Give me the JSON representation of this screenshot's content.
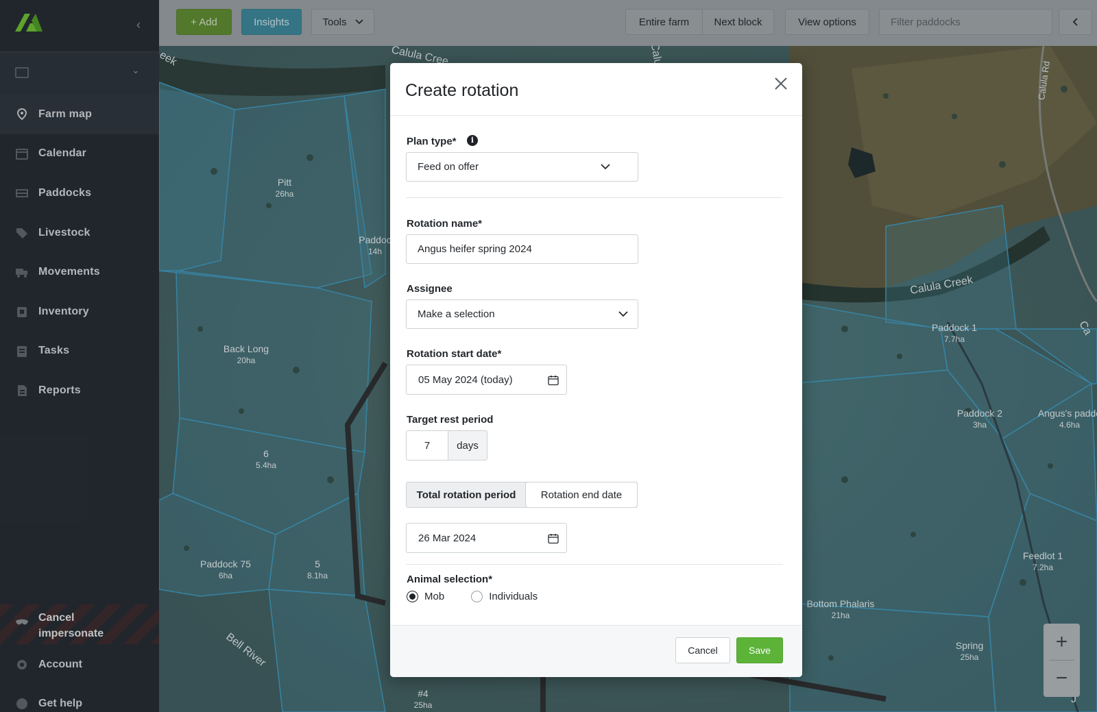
{
  "sidebar": {
    "farm_selector": {
      "value": ""
    },
    "items": [
      {
        "label": "Farm map",
        "icon": "map-pin-icon",
        "active": true
      },
      {
        "label": "Calendar",
        "icon": "calendar-icon"
      },
      {
        "label": "Paddocks",
        "icon": "fence-icon"
      },
      {
        "label": "Livestock",
        "icon": "tag-icon"
      },
      {
        "label": "Movements",
        "icon": "truck-icon"
      },
      {
        "label": "Inventory",
        "icon": "box-icon"
      },
      {
        "label": "Tasks",
        "icon": "clipboard-icon"
      },
      {
        "label": "Reports",
        "icon": "document-icon"
      }
    ],
    "cancel_impersonate": "Cancel impersonate",
    "account": "Account",
    "get_help": "Get help"
  },
  "toolbar": {
    "add": "+ Add",
    "insights": "Insights",
    "tools": "Tools",
    "entire_farm": "Entire farm",
    "next_block": "Next block",
    "view_options": "View options",
    "filter_placeholder": "Filter paddocks",
    "colors": {
      "add": "#5f8c2e",
      "insights": "#3b8799"
    }
  },
  "map": {
    "paddocks": [
      {
        "name": "Pitt",
        "area": "26ha"
      },
      {
        "name": "Paddoc",
        "area": "14h"
      },
      {
        "name": "Back Long",
        "area": "20ha"
      },
      {
        "name": "6",
        "area": "5.4ha"
      },
      {
        "name": "Paddock 75",
        "area": "6ha"
      },
      {
        "name": "5",
        "area": "8.1ha"
      },
      {
        "name": "#4",
        "area": "25ha"
      },
      {
        "name": "Paddock 1",
        "area": "7.7ha"
      },
      {
        "name": "Paddock 2",
        "area": "3ha"
      },
      {
        "name": "Angus's paddo",
        "area": "4.6ha"
      },
      {
        "name": "Feedlot 1",
        "area": "7.2ha"
      },
      {
        "name": "Bottom Phalaris",
        "area": "21ha"
      },
      {
        "name": "Spring",
        "area": "25ha"
      }
    ],
    "features": [
      "Calula Cree",
      "Calula Creek",
      "Calula Rd",
      "Bell River",
      "eek",
      "Calu",
      "Ca",
      "J"
    ],
    "zoom_in": "+",
    "zoom_out": "−"
  },
  "modal": {
    "title": "Create rotation",
    "plan_type": {
      "label": "Plan type*",
      "value": "Feed on offer"
    },
    "rotation_name": {
      "label": "Rotation name*",
      "value": "Angus heifer spring 2024"
    },
    "assignee": {
      "label": "Assignee",
      "value": "Make a selection"
    },
    "start_date": {
      "label": "Rotation start date*",
      "value": "05 May 2024 (today)"
    },
    "rest_period": {
      "label": "Target rest period",
      "value": "7",
      "unit": "days"
    },
    "period_toggle": {
      "option1": "Total rotation period",
      "option2": "Rotation end date"
    },
    "end_date": {
      "value": "26 Mar 2024"
    },
    "animal_selection": {
      "label": "Animal selection*",
      "option_mob": "Mob",
      "option_individuals": "Individuals",
      "selected": "Mob"
    },
    "cancel": "Cancel",
    "save": "Save",
    "save_color": "#5cb338"
  }
}
